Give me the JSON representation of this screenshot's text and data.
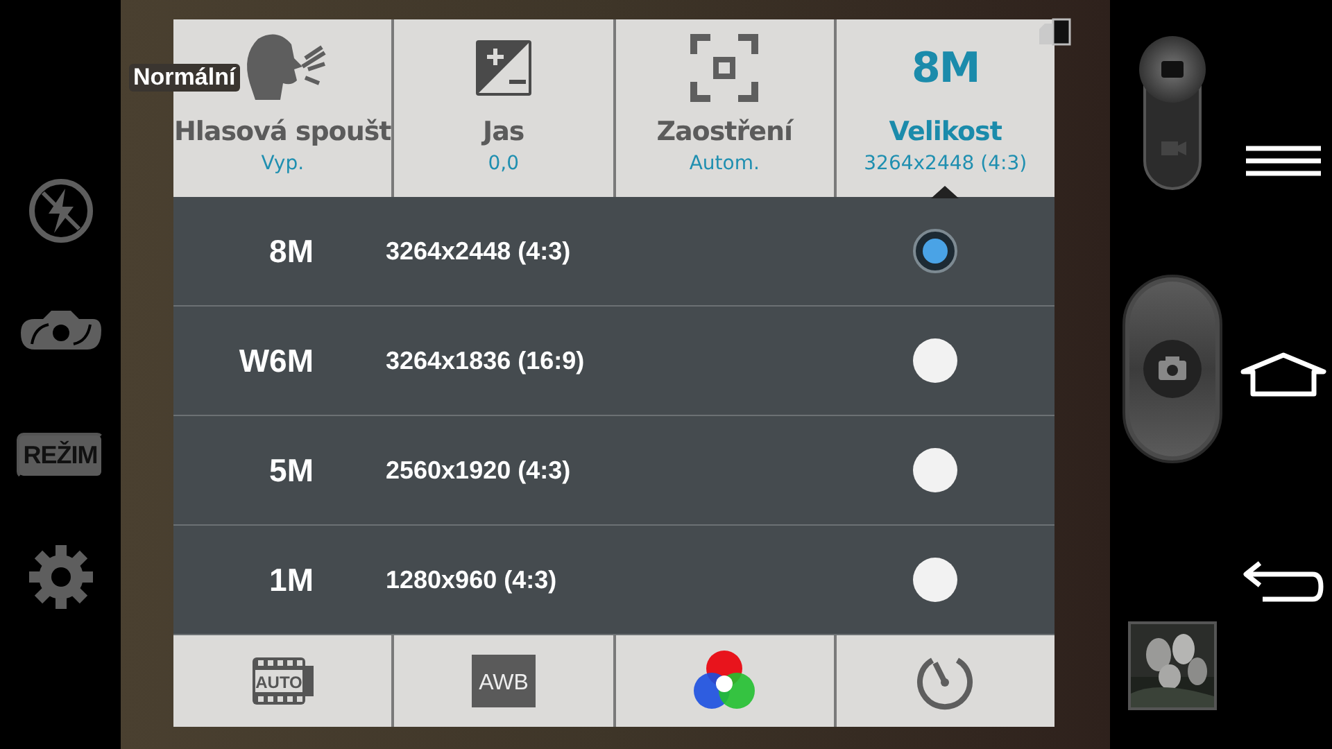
{
  "mode_label": "Normální",
  "left_bar": {
    "mode_button": "REŽIM"
  },
  "capture_switch": {
    "video": false
  },
  "settings_tabs": [
    {
      "kind": "voice",
      "label": "Hlasová spoušt",
      "value": "Vyp.",
      "selected": false
    },
    {
      "kind": "exposure",
      "label": "Jas",
      "value": "0,0",
      "selected": false
    },
    {
      "kind": "focus",
      "label": "Zaostření",
      "value": "Autom.",
      "selected": false
    },
    {
      "kind": "size",
      "badge": "8M",
      "label": "Velikost",
      "value": "3264x2448 (4:3)",
      "selected": true
    }
  ],
  "size_options": [
    {
      "name": "8M",
      "resolution": "3264x2448 (4:3)",
      "selected": true
    },
    {
      "name": "W6M",
      "resolution": "3264x1836 (16:9)",
      "selected": false
    },
    {
      "name": "5M",
      "resolution": "2560x1920 (4:3)",
      "selected": false
    },
    {
      "name": "1M",
      "resolution": "1280x960 (4:3)",
      "selected": false
    }
  ],
  "bottom_tools": [
    {
      "kind": "scene",
      "label": "AUTO"
    },
    {
      "kind": "awb",
      "label": "AWB"
    },
    {
      "kind": "color"
    },
    {
      "kind": "timer"
    }
  ]
}
